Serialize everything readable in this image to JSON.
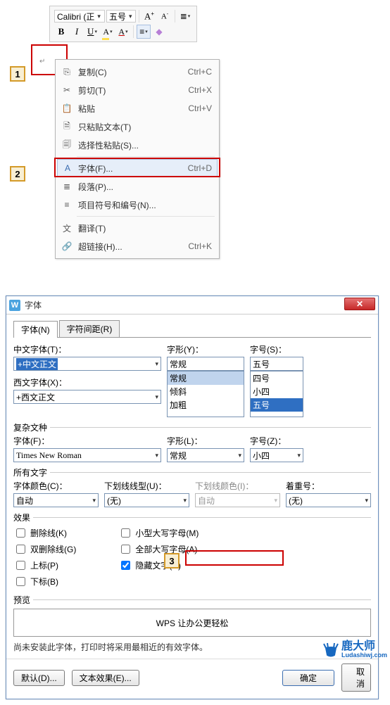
{
  "toolbar": {
    "font_name": "Calibri (正",
    "font_size": "五号"
  },
  "steps": {
    "s1": "1",
    "s2": "2",
    "s3": "3"
  },
  "context_menu": {
    "copy": {
      "label": "复制(C)",
      "shortcut": "Ctrl+C"
    },
    "cut": {
      "label": "剪切(T)",
      "shortcut": "Ctrl+X"
    },
    "paste": {
      "label": "粘贴",
      "shortcut": "Ctrl+V"
    },
    "paste_text": {
      "label": "只粘贴文本(T)"
    },
    "paste_special": {
      "label": "选择性粘贴(S)..."
    },
    "font": {
      "label": "字体(F)...",
      "shortcut": "Ctrl+D"
    },
    "paragraph": {
      "label": "段落(P)..."
    },
    "bullets": {
      "label": "项目符号和编号(N)..."
    },
    "translate": {
      "label": "翻译(T)"
    },
    "hyperlink": {
      "label": "超链接(H)...",
      "shortcut": "Ctrl+K"
    }
  },
  "dialog": {
    "title": "字体",
    "tab_font": "字体(N)",
    "tab_spacing": "字符间距(R)",
    "cn_font_label": "中文字体(T)：",
    "cn_font_value": "+中文正文",
    "en_font_label": "西文字体(X)：",
    "en_font_value": "+西文正文",
    "style_label": "字形(Y)：",
    "style_value": "常规",
    "style_list": [
      "常规",
      "倾斜",
      "加粗"
    ],
    "size_label": "字号(S)：",
    "size_value": "五号",
    "size_list": [
      "四号",
      "小四",
      "五号"
    ],
    "complex_section": "复杂文种",
    "cx_font_label": "字体(F)：",
    "cx_font_value": "Times New Roman",
    "cx_style_label": "字形(L)：",
    "cx_style_value": "常规",
    "cx_size_label": "字号(Z)：",
    "cx_size_value": "小四",
    "all_text_section": "所有文字",
    "font_color_label": "字体颜色(C)：",
    "font_color_value": "自动",
    "underline_style_label": "下划线线型(U)：",
    "underline_style_value": "(无)",
    "underline_color_label": "下划线颜色(I)：",
    "underline_color_value": "自动",
    "emphasis_label": "着重号：",
    "emphasis_value": "(无)",
    "effects_section": "效果",
    "chk_strike": "删除线(K)",
    "chk_dstrike": "双删除线(G)",
    "chk_sup": "上标(P)",
    "chk_sub": "下标(B)",
    "chk_smallcaps": "小型大写字母(M)",
    "chk_allcaps": "全部大写字母(A)",
    "chk_hidden": "隐藏文字(H)",
    "preview_section": "预览",
    "preview_text": "WPS 让办公更轻松",
    "note": "尚未安装此字体，打印时将采用最相近的有效字体。",
    "btn_default": "默认(D)...",
    "btn_texteffect": "文本效果(E)...",
    "btn_ok": "确定",
    "btn_cancel": "取消"
  },
  "watermark": {
    "brand": "鹿大师",
    "domain": "Ludashiwj.com"
  }
}
